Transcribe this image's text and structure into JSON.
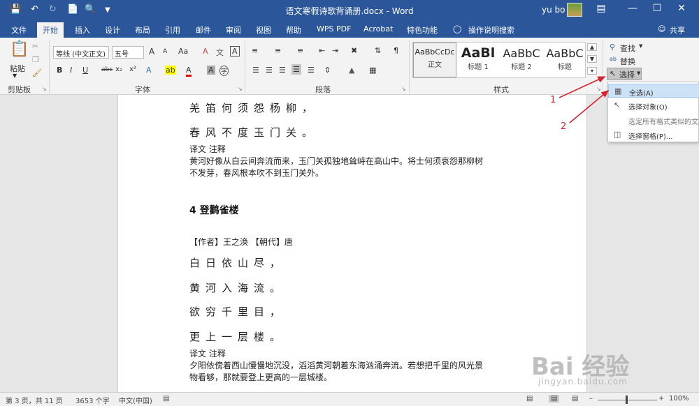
{
  "titlebar": {
    "document_title": "语文寒假诗歌背诵册.docx - Word",
    "user_name": "yu bo",
    "icons": {
      "save": "save-icon",
      "undo": "undo-icon",
      "redo": "redo-icon",
      "new": "new-doc-icon",
      "print_preview": "print-preview-icon",
      "customize": "customize-qat-icon"
    }
  },
  "tabs": [
    "文件",
    "开始",
    "插入",
    "设计",
    "布局",
    "引用",
    "邮件",
    "审阅",
    "视图",
    "帮助",
    "WPS PDF",
    "Acrobat",
    "特色功能",
    "操作说明搜索",
    "共享"
  ],
  "ribbon": {
    "clipboard": {
      "paste_label": "粘贴",
      "group_label": "剪贴板"
    },
    "font": {
      "font_name": "等线 (中文正文)",
      "font_size": "五号",
      "grow": "A",
      "shrink": "A",
      "case": "Aa",
      "clear": "A",
      "char_border": "A",
      "bold": "B",
      "italic": "I",
      "underline": "U",
      "strike": "abc",
      "subscript": "x₂",
      "superscript": "x²",
      "effect": "A",
      "highlight": "ab",
      "color": "A",
      "char_shade": "A",
      "enclose": "字",
      "group_label": "字体"
    },
    "paragraph": {
      "group_label": "段落"
    },
    "styles": {
      "items": [
        {
          "sample": "AaBbCcDc",
          "name": "正文"
        },
        {
          "sample": "AaBl",
          "name": "标题 1"
        },
        {
          "sample": "AaBbC",
          "name": "标题 2"
        },
        {
          "sample": "AaBbC",
          "name": "标题"
        }
      ],
      "group_label": "样式"
    },
    "editing": {
      "find": "查找",
      "replace": "替换",
      "select": "选择"
    }
  },
  "select_menu": {
    "items": [
      {
        "label": "全选(A)",
        "icon": "select-all-icon"
      },
      {
        "label": "选择对象(O)",
        "icon": "select-objects-icon"
      },
      {
        "label": "选定所有格式类似的文本(无数据)",
        "icon": ""
      },
      {
        "label": "选择窗格(P)...",
        "icon": "selection-pane-icon"
      }
    ]
  },
  "annotations": {
    "step1": "1",
    "step2": "2"
  },
  "document": {
    "lines": [
      "羌笛何须怨杨柳，",
      "春风不度玉门关。",
      "译文 注释",
      "黄河好像从白云间奔流而来，玉门关孤独地耸峙在高山中。将士何须哀怨那柳树",
      "不发芽，春风根本吹不到玉门关外。",
      "4  登鹳雀楼",
      "【作者】王之涣 【朝代】唐",
      "白日依山尽，",
      "黄河入海流。",
      "欲穷千里目，",
      "更上一层楼。",
      "译文 注释",
      "夕阳依傍着西山慢慢地沉没，滔滔黄河朝着东海汹涌奔流。若想把千里的风光景",
      "物看够，那就要登上更高的一层城楼。"
    ]
  },
  "statusbar": {
    "page": "第 3 页，共 11 页",
    "words": "3653 个字",
    "lang": "中文(中国)",
    "zoom": "100%"
  },
  "watermark": {
    "logo": "Bai 经验",
    "url": "jingyan.baidu.com"
  },
  "colors": {
    "accent": "#2b579a",
    "annotation": "#d9232e"
  }
}
